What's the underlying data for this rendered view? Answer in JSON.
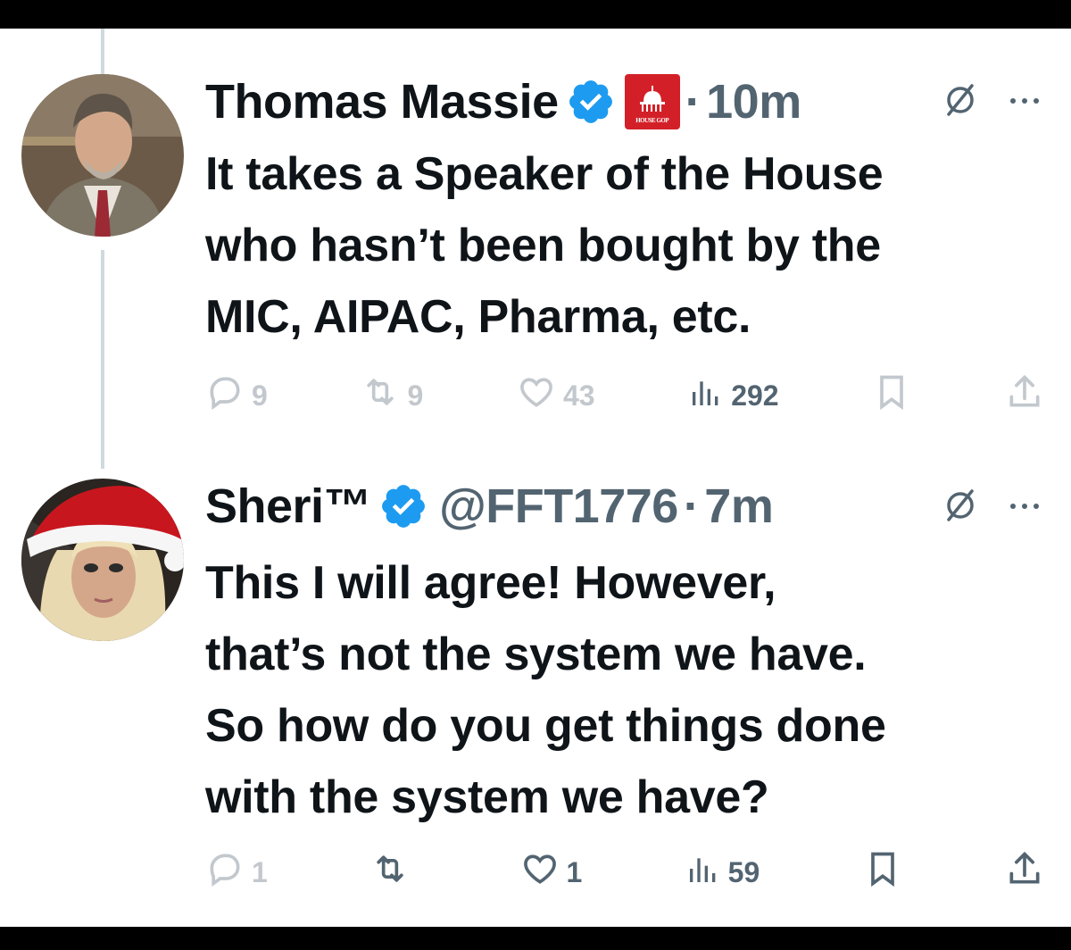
{
  "tweets": [
    {
      "author": {
        "name": "Thomas Massie",
        "verified": true,
        "affiliation_badge": "House GOP capitol logo",
        "affiliation_text": "HOUSE GOP"
      },
      "time": "10m",
      "text": "It takes a Speaker of the House\nwho hasn’t been bought by the\nMIC, AIPAC, Pharma, etc.",
      "actions": {
        "replies": "9",
        "reposts": "9",
        "likes": "43",
        "views": "292"
      }
    },
    {
      "author": {
        "name": "Sheri™",
        "handle": "@FFT1776",
        "verified": true
      },
      "time": "7m",
      "text": "This I will agree!  However,\nthat’s not the system we have.\nSo how do you get things done\nwith the system we have?",
      "actions": {
        "replies": "1",
        "reposts": "",
        "likes": "1",
        "views": "59"
      }
    }
  ],
  "icons": {
    "verified": "verified-badge-icon",
    "grok": "grok-slash-icon",
    "more": "more-dots-icon",
    "reply": "reply-icon",
    "repost": "repost-icon",
    "like": "heart-icon",
    "views": "views-bar-icon",
    "bookmark": "bookmark-icon",
    "share": "share-icon"
  },
  "colors": {
    "text": "#0f1419",
    "muted": "#536471",
    "verified": "#1d9bf0",
    "thread_line": "#cfd9de",
    "affiliation_red": "#d32028"
  }
}
